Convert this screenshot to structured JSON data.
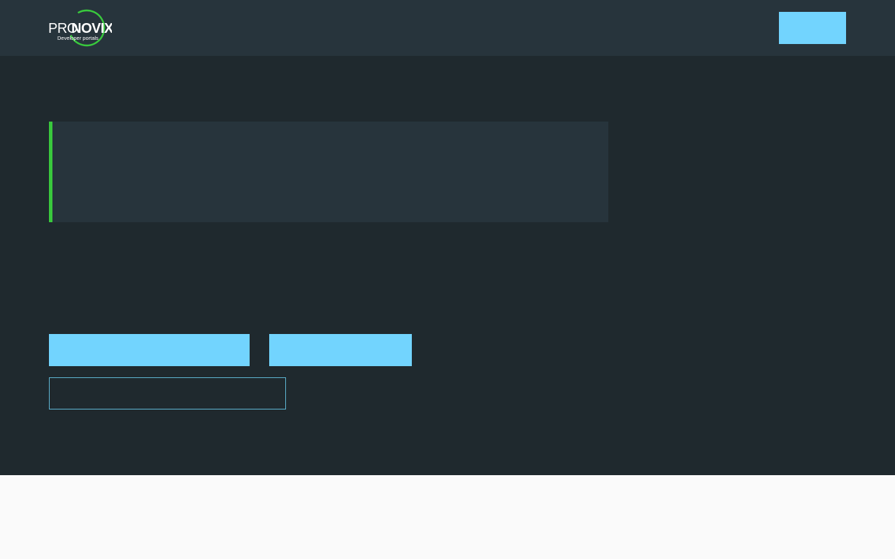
{
  "header": {
    "logo": {
      "brand_pro": "PRO",
      "brand_novix": "NOVIX",
      "tagline": "Developer portals"
    },
    "cta_label": ""
  },
  "hero": {
    "notice_text": "",
    "buttons": {
      "primary_1_label": "",
      "primary_2_label": "",
      "outline_label": ""
    }
  },
  "colors": {
    "header_bg": "#27343c",
    "hero_bg": "#1f292e",
    "accent_blue": "#72d4fe",
    "accent_green": "#39c93d",
    "page_bg": "#fafafa"
  }
}
